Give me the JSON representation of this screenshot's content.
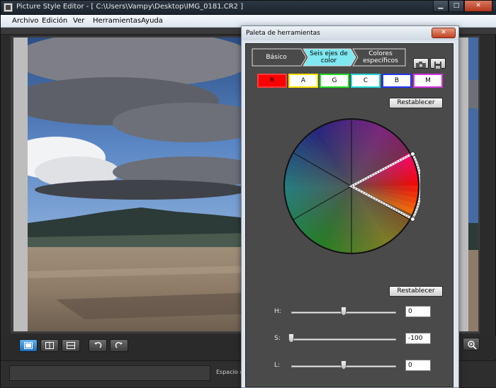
{
  "window": {
    "title": "Picture Style Editor - [ C:\\Users\\Vampy\\Desktop\\IMG_0181.CR2 ]",
    "controls": {
      "minimize": "▁",
      "maximize": "□",
      "close": "✕"
    }
  },
  "menu": {
    "items": [
      "Archivo",
      "Edición",
      "Ver",
      "Herramientas",
      "Ayuda"
    ]
  },
  "viewer": {
    "icons": [
      "single-view-icon",
      "split-view-icon",
      "compare-view-icon",
      "rotate-left-icon",
      "rotate-right-icon"
    ],
    "zoom_icon": "zoom-icon"
  },
  "status": {
    "field_value": "",
    "text": "Espacio de c"
  },
  "palette": {
    "title": "Paleta de herramientas",
    "close": "✕",
    "tabs": [
      {
        "label": "Básico",
        "active": false
      },
      {
        "label": "Seis ejes de color",
        "active": true
      },
      {
        "label": "Colores específicos",
        "active": false
      }
    ],
    "colors": [
      {
        "label": "R",
        "fill": "#ff0000",
        "border": "#ff3b3b",
        "selected": true
      },
      {
        "label": "A",
        "fill": "#ffffff",
        "border": "#ffe000",
        "selected": false
      },
      {
        "label": "G",
        "fill": "#ffffff",
        "border": "#22dd22",
        "selected": false
      },
      {
        "label": "C",
        "fill": "#ffffff",
        "border": "#22d8d8",
        "selected": false
      },
      {
        "label": "B",
        "fill": "#ffffff",
        "border": "#2233ff",
        "selected": false
      },
      {
        "label": "M",
        "fill": "#ffffff",
        "border": "#d633e0",
        "selected": false
      }
    ],
    "reset_top": "Restablecer",
    "reset_bottom": "Restablecer",
    "sliders": [
      {
        "label": "H:",
        "value": "0",
        "level": 0.5
      },
      {
        "label": "S:",
        "value": "-100",
        "level": 0.0
      },
      {
        "label": "L:",
        "value": "0",
        "level": 0.5
      }
    ],
    "icons": [
      "camera-save-icon",
      "disk-save-icon"
    ]
  }
}
